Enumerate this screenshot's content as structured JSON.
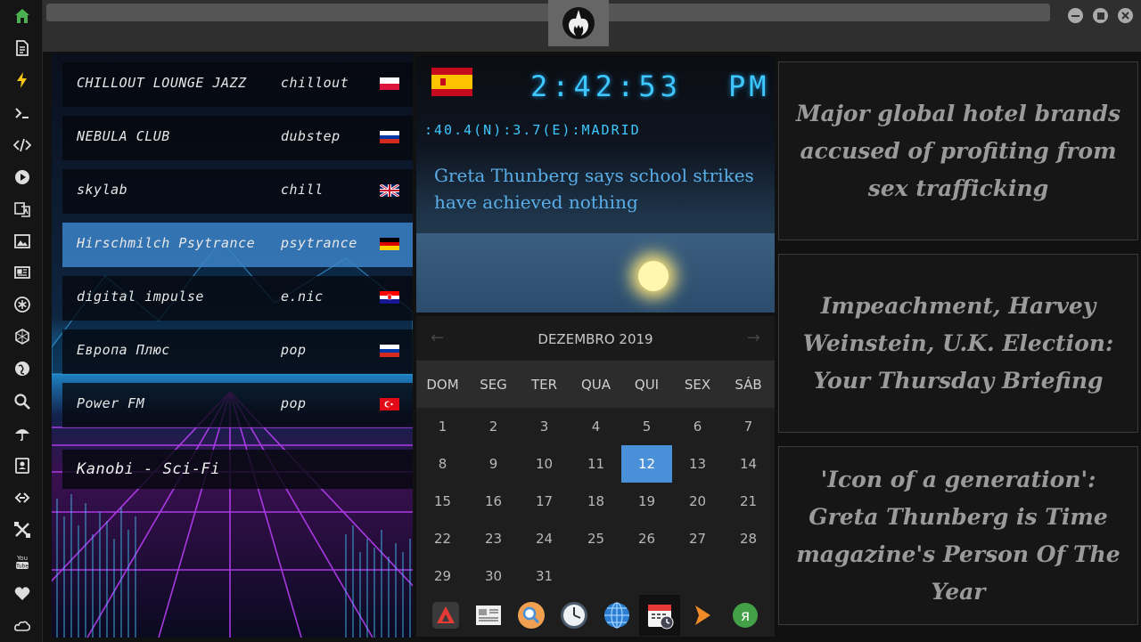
{
  "dock": {
    "icons": [
      "home-icon",
      "document-icon",
      "lightning-icon",
      "terminal-icon",
      "code-icon",
      "play-icon",
      "translate-icon",
      "image-icon",
      "news-icon",
      "star-icon",
      "hexagon-icon",
      "globe-icon",
      "search-icon",
      "umbrella-icon",
      "contacts-icon",
      "link-icon",
      "tools-icon",
      "youtube-icon",
      "heart-icon",
      "cloud-icon"
    ]
  },
  "radio": {
    "stations": [
      {
        "name": "CHILLOUT LOUNGE JAZZ",
        "genre": "chillout",
        "flag": "poland"
      },
      {
        "name": "NEBULA CLUB",
        "genre": "dubstep",
        "flag": "russia"
      },
      {
        "name": "skylab",
        "genre": "chill",
        "flag": "uk"
      },
      {
        "name": "Hirschmilch Psytrance",
        "genre": "psytrance",
        "flag": "germany"
      },
      {
        "name": "digital impulse",
        "genre": "e.nic",
        "flag": "croatia"
      },
      {
        "name": "Европа Плюс",
        "genre": "pop",
        "flag": "russia"
      },
      {
        "name": "Power FM",
        "genre": "pop",
        "flag": "turkey"
      }
    ],
    "active_index": 3,
    "now_playing": "Kanobi - Sci-Fi"
  },
  "clock": {
    "time": "2:42:53",
    "ampm": "PM",
    "coords": ":40.4(N):3.7(E):MADRID",
    "headline": "Greta Thunberg says school strikes have achieved nothing",
    "flag": "spain"
  },
  "calendar": {
    "title": "DEZEMBRO 2019",
    "prev": "←",
    "next": "→",
    "weekdays": [
      "DOM",
      "SEG",
      "TER",
      "QUA",
      "QUI",
      "SEX",
      "SÁB"
    ],
    "days": [
      "1",
      "2",
      "3",
      "4",
      "5",
      "6",
      "7",
      "8",
      "9",
      "10",
      "11",
      "12",
      "13",
      "14",
      "15",
      "16",
      "17",
      "18",
      "19",
      "20",
      "21",
      "22",
      "23",
      "24",
      "25",
      "26",
      "27",
      "28",
      "29",
      "30",
      "31"
    ],
    "today": "12"
  },
  "taskbar": {
    "apps": [
      "app-launcher-icon",
      "news-reader-icon",
      "search-app-icon",
      "clock-app-icon",
      "globe-app-icon",
      "calendar-app-icon",
      "play-arrow-icon",
      "yandex-icon"
    ],
    "active_index": 5
  },
  "news": [
    {
      "headline": "Major global hotel brands accused of profiting from sex trafficking"
    },
    {
      "headline": "Impeachment, Harvey Weinstein, U.K. Election: Your Thursday Briefing"
    },
    {
      "headline": "'Icon of a generation': Greta Thunberg is Time magazine's Person Of The Year"
    }
  ],
  "colors": {
    "accent": "#4a90d9",
    "clock_digits": "#3fc8ff",
    "dock_home": "#4caf50",
    "dock_lightning": "#f5c518"
  }
}
